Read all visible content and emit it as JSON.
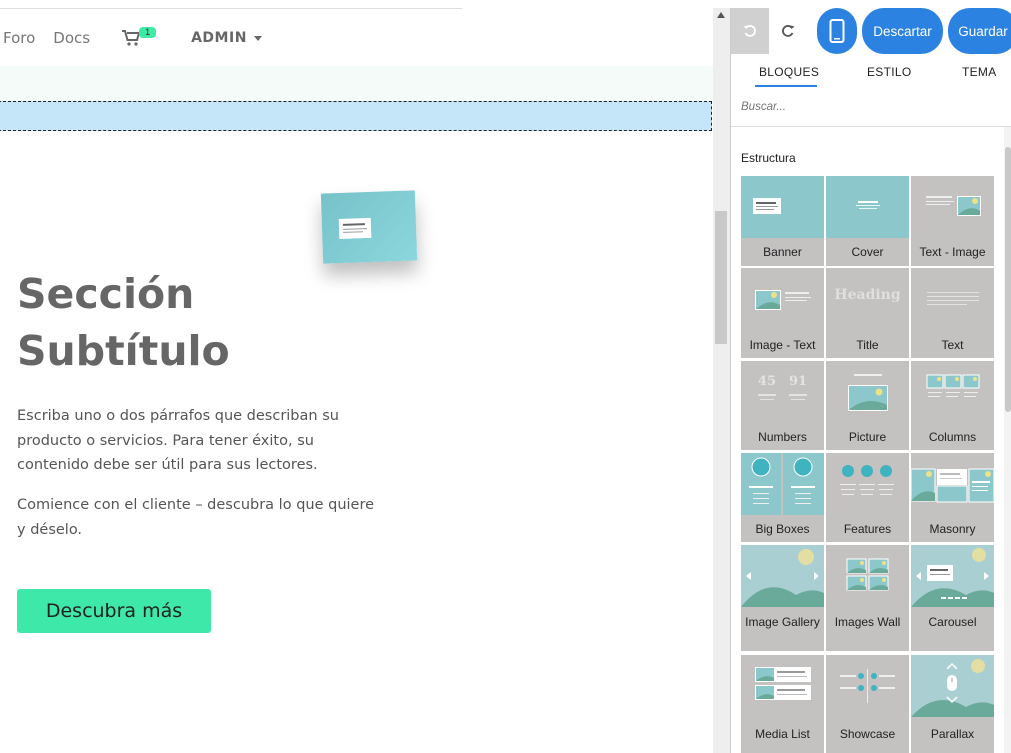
{
  "navbar": {
    "links": [
      "Foro",
      "Docs"
    ],
    "cart_count": "1",
    "user_menu": "ADMIN"
  },
  "hero": {
    "title_line1": "Sección",
    "title_line2": "Subtítulo",
    "paragraph1": "Escriba uno o dos párrafos que describan su producto o servicios. Para tener éxito, su contenido debe ser útil para sus lectores.",
    "paragraph2": "Comience con el cliente – descubra lo que quiere y déselo.",
    "cta_label": "Descubra más"
  },
  "editor": {
    "discard_label": "Descartar",
    "save_label": "Guardar",
    "tabs": [
      "BLOQUES",
      "ESTILO",
      "TEMA"
    ],
    "active_tab": "BLOQUES",
    "search_placeholder": "Buscar...",
    "section_title": "Estructura",
    "blocks": [
      {
        "label": "Banner",
        "icon": "banner-snippet-icon"
      },
      {
        "label": "Cover",
        "icon": "cover-snippet-icon"
      },
      {
        "label": "Text - Image",
        "icon": "text-image-snippet-icon"
      },
      {
        "label": "Image - Text",
        "icon": "image-text-snippet-icon"
      },
      {
        "label": "Title",
        "icon": "title-snippet-icon",
        "thumb_text": "Heading"
      },
      {
        "label": "Text",
        "icon": "text-snippet-icon"
      },
      {
        "label": "Numbers",
        "icon": "numbers-snippet-icon",
        "thumb_numbers": [
          "45",
          "91"
        ]
      },
      {
        "label": "Picture",
        "icon": "picture-snippet-icon"
      },
      {
        "label": "Columns",
        "icon": "columns-snippet-icon"
      },
      {
        "label": "Big Boxes",
        "icon": "big-boxes-snippet-icon"
      },
      {
        "label": "Features",
        "icon": "features-snippet-icon"
      },
      {
        "label": "Masonry",
        "icon": "masonry-snippet-icon"
      },
      {
        "label": "Image Gallery",
        "icon": "image-gallery-snippet-icon"
      },
      {
        "label": "Images Wall",
        "icon": "images-wall-snippet-icon"
      },
      {
        "label": "Carousel",
        "icon": "carousel-snippet-icon"
      },
      {
        "label": "Media List",
        "icon": "media-list-snippet-icon"
      },
      {
        "label": "Showcase",
        "icon": "showcase-snippet-icon"
      },
      {
        "label": "Parallax",
        "icon": "parallax-snippet-icon"
      }
    ]
  },
  "colors": {
    "accent_blue": "#2b82e0",
    "cta_green": "#3ee8a8",
    "drop_zone": "#c5e6f8",
    "block_bg": "#c4c1c1",
    "thumb_teal": "#8cc7cc"
  }
}
